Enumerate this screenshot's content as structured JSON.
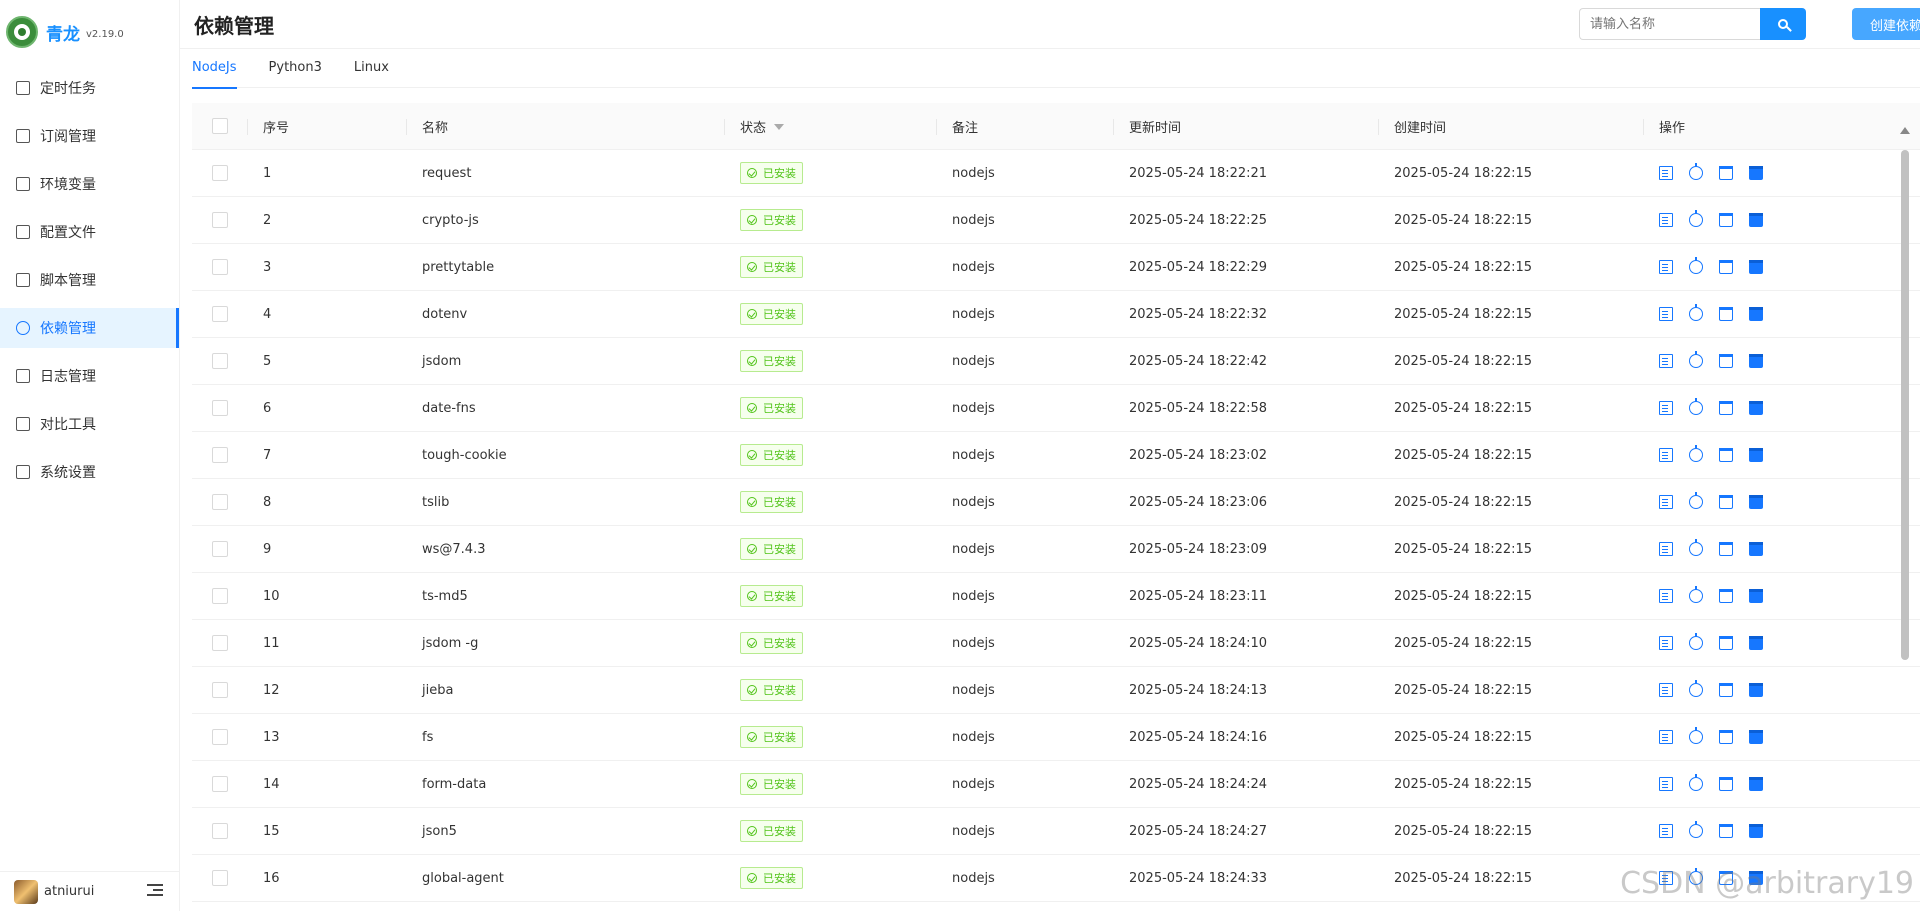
{
  "brand": {
    "name": "青龙",
    "version": "v2.19.0"
  },
  "sidebar": {
    "items": [
      {
        "label": "定时任务",
        "icon": "calendar-icon"
      },
      {
        "label": "订阅管理",
        "icon": "subscription-icon"
      },
      {
        "label": "环境变量",
        "icon": "monitor-icon"
      },
      {
        "label": "配置文件",
        "icon": "sliders-icon"
      },
      {
        "label": "脚本管理",
        "icon": "script-icon"
      },
      {
        "label": "依赖管理",
        "icon": "dependency-icon",
        "active": true
      },
      {
        "label": "日志管理",
        "icon": "log-icon"
      },
      {
        "label": "对比工具",
        "icon": "diff-icon"
      },
      {
        "label": "系统设置",
        "icon": "gear-icon"
      }
    ],
    "user": {
      "name": "atniurui"
    }
  },
  "header": {
    "title": "依赖管理"
  },
  "search": {
    "placeholder": "请输入名称"
  },
  "create_button": "创建依赖",
  "tabs": [
    {
      "label": "NodeJs",
      "active": true
    },
    {
      "label": "Python3"
    },
    {
      "label": "Linux"
    }
  ],
  "table": {
    "columns": {
      "index": "序号",
      "name": "名称",
      "status": "状态",
      "note": "备注",
      "updated": "更新时间",
      "created": "创建时间",
      "actions": "操作"
    },
    "rows": [
      {
        "index": "1",
        "name": "request",
        "status": "已安装",
        "note": "nodejs",
        "updated": "2025-05-24 18:22:21",
        "created": "2025-05-24 18:22:15"
      },
      {
        "index": "2",
        "name": "crypto-js",
        "status": "已安装",
        "note": "nodejs",
        "updated": "2025-05-24 18:22:25",
        "created": "2025-05-24 18:22:15"
      },
      {
        "index": "3",
        "name": "prettytable",
        "status": "已安装",
        "note": "nodejs",
        "updated": "2025-05-24 18:22:29",
        "created": "2025-05-24 18:22:15"
      },
      {
        "index": "4",
        "name": "dotenv",
        "status": "已安装",
        "note": "nodejs",
        "updated": "2025-05-24 18:22:32",
        "created": "2025-05-24 18:22:15"
      },
      {
        "index": "5",
        "name": "jsdom",
        "status": "已安装",
        "note": "nodejs",
        "updated": "2025-05-24 18:22:42",
        "created": "2025-05-24 18:22:15"
      },
      {
        "index": "6",
        "name": "date-fns",
        "status": "已安装",
        "note": "nodejs",
        "updated": "2025-05-24 18:22:58",
        "created": "2025-05-24 18:22:15"
      },
      {
        "index": "7",
        "name": "tough-cookie",
        "status": "已安装",
        "note": "nodejs",
        "updated": "2025-05-24 18:23:02",
        "created": "2025-05-24 18:22:15"
      },
      {
        "index": "8",
        "name": "tslib",
        "status": "已安装",
        "note": "nodejs",
        "updated": "2025-05-24 18:23:06",
        "created": "2025-05-24 18:22:15"
      },
      {
        "index": "9",
        "name": "ws@7.4.3",
        "status": "已安装",
        "note": "nodejs",
        "updated": "2025-05-24 18:23:09",
        "created": "2025-05-24 18:22:15"
      },
      {
        "index": "10",
        "name": "ts-md5",
        "status": "已安装",
        "note": "nodejs",
        "updated": "2025-05-24 18:23:11",
        "created": "2025-05-24 18:22:15"
      },
      {
        "index": "11",
        "name": "jsdom -g",
        "status": "已安装",
        "note": "nodejs",
        "updated": "2025-05-24 18:24:10",
        "created": "2025-05-24 18:22:15"
      },
      {
        "index": "12",
        "name": "jieba",
        "status": "已安装",
        "note": "nodejs",
        "updated": "2025-05-24 18:24:13",
        "created": "2025-05-24 18:22:15"
      },
      {
        "index": "13",
        "name": "fs",
        "status": "已安装",
        "note": "nodejs",
        "updated": "2025-05-24 18:24:16",
        "created": "2025-05-24 18:22:15"
      },
      {
        "index": "14",
        "name": "form-data",
        "status": "已安装",
        "note": "nodejs",
        "updated": "2025-05-24 18:24:24",
        "created": "2025-05-24 18:22:15"
      },
      {
        "index": "15",
        "name": "json5",
        "status": "已安装",
        "note": "nodejs",
        "updated": "2025-05-24 18:24:27",
        "created": "2025-05-24 18:22:15"
      },
      {
        "index": "16",
        "name": "global-agent",
        "status": "已安装",
        "note": "nodejs",
        "updated": "2025-05-24 18:24:33",
        "created": "2025-05-24 18:22:15"
      }
    ]
  },
  "watermark": "CSDN @arbitrary19",
  "colors": {
    "accent": "#1677ff",
    "success": "#52c41a",
    "success_bg": "#f6ffed"
  }
}
